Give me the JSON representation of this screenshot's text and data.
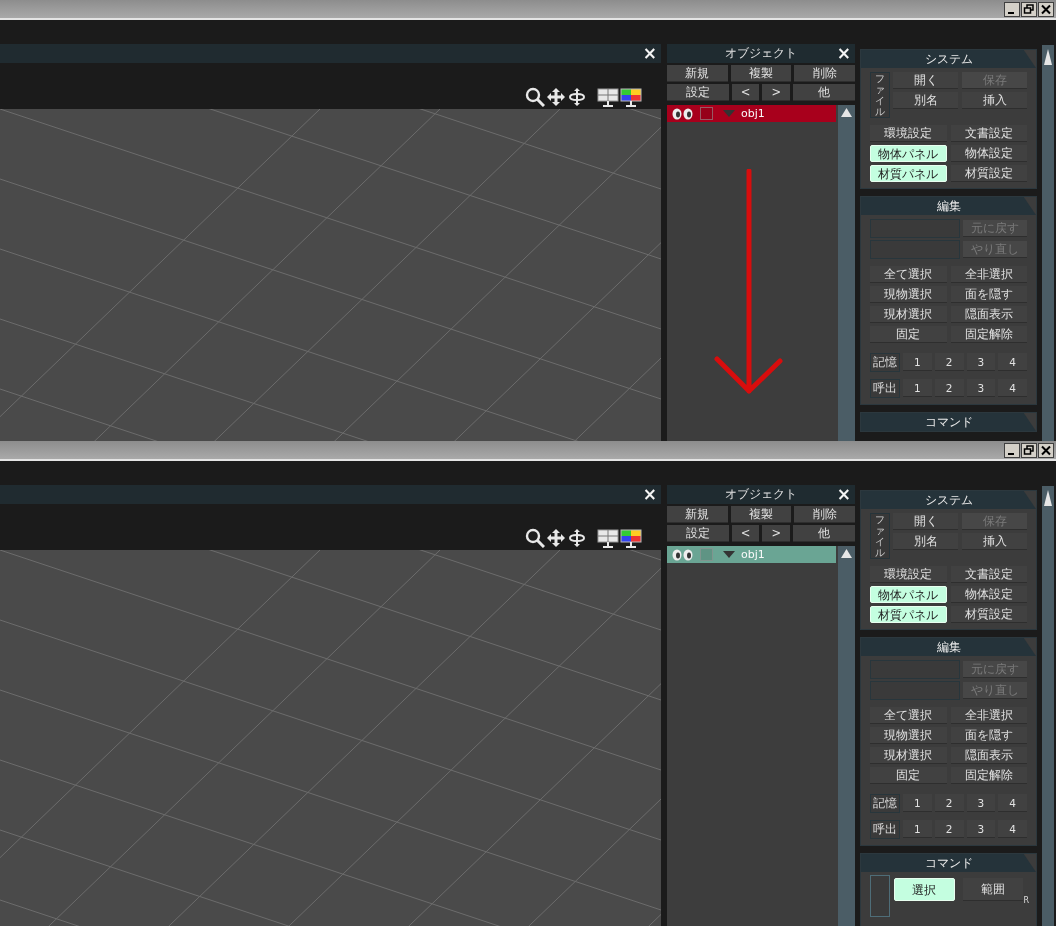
{
  "screens": [
    {
      "arrow_overlay": true,
      "viewport": {
        "close": "×"
      },
      "object_panel": {
        "title": "オブジェクト",
        "close": "×",
        "button_rows": [
          [
            {
              "label": "新規"
            },
            {
              "label": "複製"
            },
            {
              "label": "削除"
            }
          ],
          [
            {
              "label": "設定"
            },
            {
              "label": "<"
            },
            {
              "label": ">"
            },
            {
              "label": "他"
            }
          ]
        ],
        "objects": [
          {
            "name": "obj1",
            "color": "#a8001c",
            "visible": true,
            "locked": false,
            "expanded": true
          }
        ]
      },
      "system_panel": {
        "title": "システム",
        "file_label": "ファイル",
        "file_buttons": [
          {
            "label": "開く",
            "disabled": false
          },
          {
            "label": "保存",
            "disabled": true
          },
          {
            "label": "別名",
            "disabled": false
          },
          {
            "label": "挿入",
            "disabled": false
          }
        ],
        "buttons": [
          {
            "label": "環境設定",
            "on": false
          },
          {
            "label": "文書設定",
            "on": false
          },
          {
            "label": "物体パネル",
            "on": true
          },
          {
            "label": "物体設定",
            "on": false
          },
          {
            "label": "材質パネル",
            "on": true
          },
          {
            "label": "材質設定",
            "on": false
          }
        ]
      },
      "edit_panel": {
        "title": "編集",
        "history": [
          {
            "label": "元に戻す",
            "disabled": true
          },
          {
            "label": "やり直し",
            "disabled": true
          }
        ],
        "buttons": [
          {
            "label": "全て選択"
          },
          {
            "label": "全非選択"
          },
          {
            "label": "現物選択"
          },
          {
            "label": "面を隠す"
          },
          {
            "label": "現材選択"
          },
          {
            "label": "隠面表示"
          },
          {
            "label": "固定"
          },
          {
            "label": "固定解除"
          }
        ],
        "slot_rows": [
          {
            "label": "記憶",
            "slots": [
              "1",
              "2",
              "3",
              "4"
            ]
          },
          {
            "label": "呼出",
            "slots": [
              "1",
              "2",
              "3",
              "4"
            ]
          }
        ]
      },
      "command_panel": {
        "title": "コマンド"
      }
    },
    {
      "viewport": {
        "close": "×"
      },
      "object_panel": {
        "title": "オブジェクト",
        "close": "×",
        "button_rows": [
          [
            {
              "label": "新規"
            },
            {
              "label": "複製"
            },
            {
              "label": "削除"
            }
          ],
          [
            {
              "label": "設定"
            },
            {
              "label": "<"
            },
            {
              "label": ">"
            },
            {
              "label": "他"
            }
          ]
        ],
        "objects": [
          {
            "name": "obj1",
            "color": "#6aa594",
            "visible": true,
            "locked": false,
            "expanded": true
          }
        ]
      },
      "system_panel": {
        "title": "システム",
        "file_label": "ファイル",
        "file_buttons": [
          {
            "label": "開く",
            "disabled": false
          },
          {
            "label": "保存",
            "disabled": true
          },
          {
            "label": "別名",
            "disabled": false
          },
          {
            "label": "挿入",
            "disabled": false
          }
        ],
        "buttons": [
          {
            "label": "環境設定",
            "on": false
          },
          {
            "label": "文書設定",
            "on": false
          },
          {
            "label": "物体パネル",
            "on": true
          },
          {
            "label": "物体設定",
            "on": false
          },
          {
            "label": "材質パネル",
            "on": true
          },
          {
            "label": "材質設定",
            "on": false
          }
        ]
      },
      "edit_panel": {
        "title": "編集",
        "history": [
          {
            "label": "元に戻す",
            "disabled": true
          },
          {
            "label": "やり直し",
            "disabled": true
          }
        ],
        "buttons": [
          {
            "label": "全て選択"
          },
          {
            "label": "全非選択"
          },
          {
            "label": "現物選択"
          },
          {
            "label": "面を隠す"
          },
          {
            "label": "現材選択"
          },
          {
            "label": "隠面表示"
          },
          {
            "label": "固定"
          },
          {
            "label": "固定解除"
          }
        ],
        "slot_rows": [
          {
            "label": "記憶",
            "slots": [
              "1",
              "2",
              "3",
              "4"
            ]
          },
          {
            "label": "呼出",
            "slots": [
              "1",
              "2",
              "3",
              "4"
            ]
          }
        ]
      },
      "command_panel": {
        "title": "コマンド",
        "buttons": [
          {
            "label": "選択",
            "on": true
          },
          {
            "label": "範囲",
            "on": false,
            "shortcut": "R"
          }
        ]
      }
    }
  ]
}
